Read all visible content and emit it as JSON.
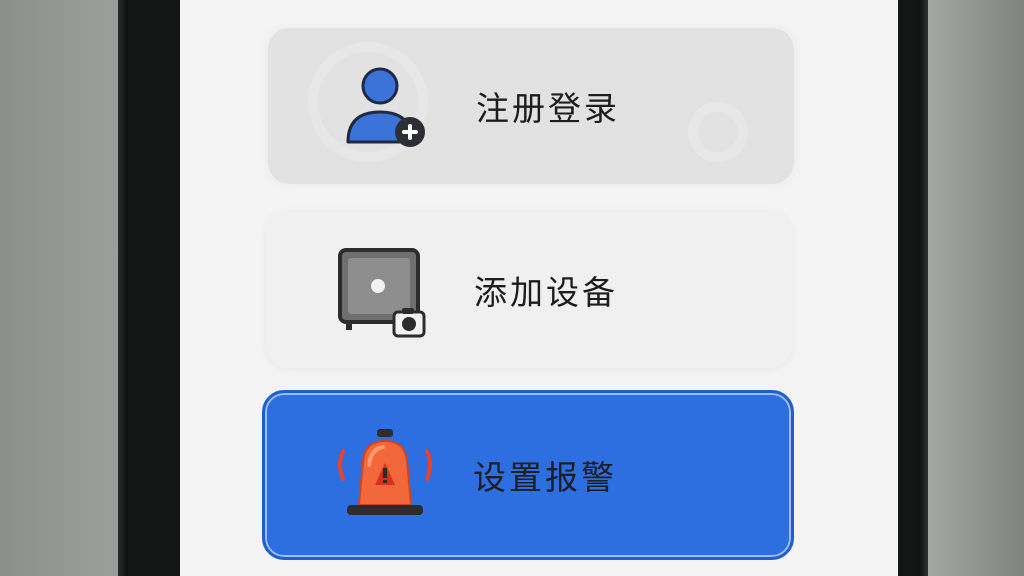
{
  "menu": {
    "register": {
      "label": "注册登录",
      "icon": "add-user-icon"
    },
    "add_device": {
      "label": "添加设备",
      "icon": "device-camera-icon"
    },
    "set_alarm": {
      "label": "设置报警",
      "icon": "alarm-siren-icon",
      "selected": true
    }
  },
  "colors": {
    "accent": "#2d6ee0",
    "user_icon": "#3b73d8",
    "siren": "#f2683a"
  }
}
